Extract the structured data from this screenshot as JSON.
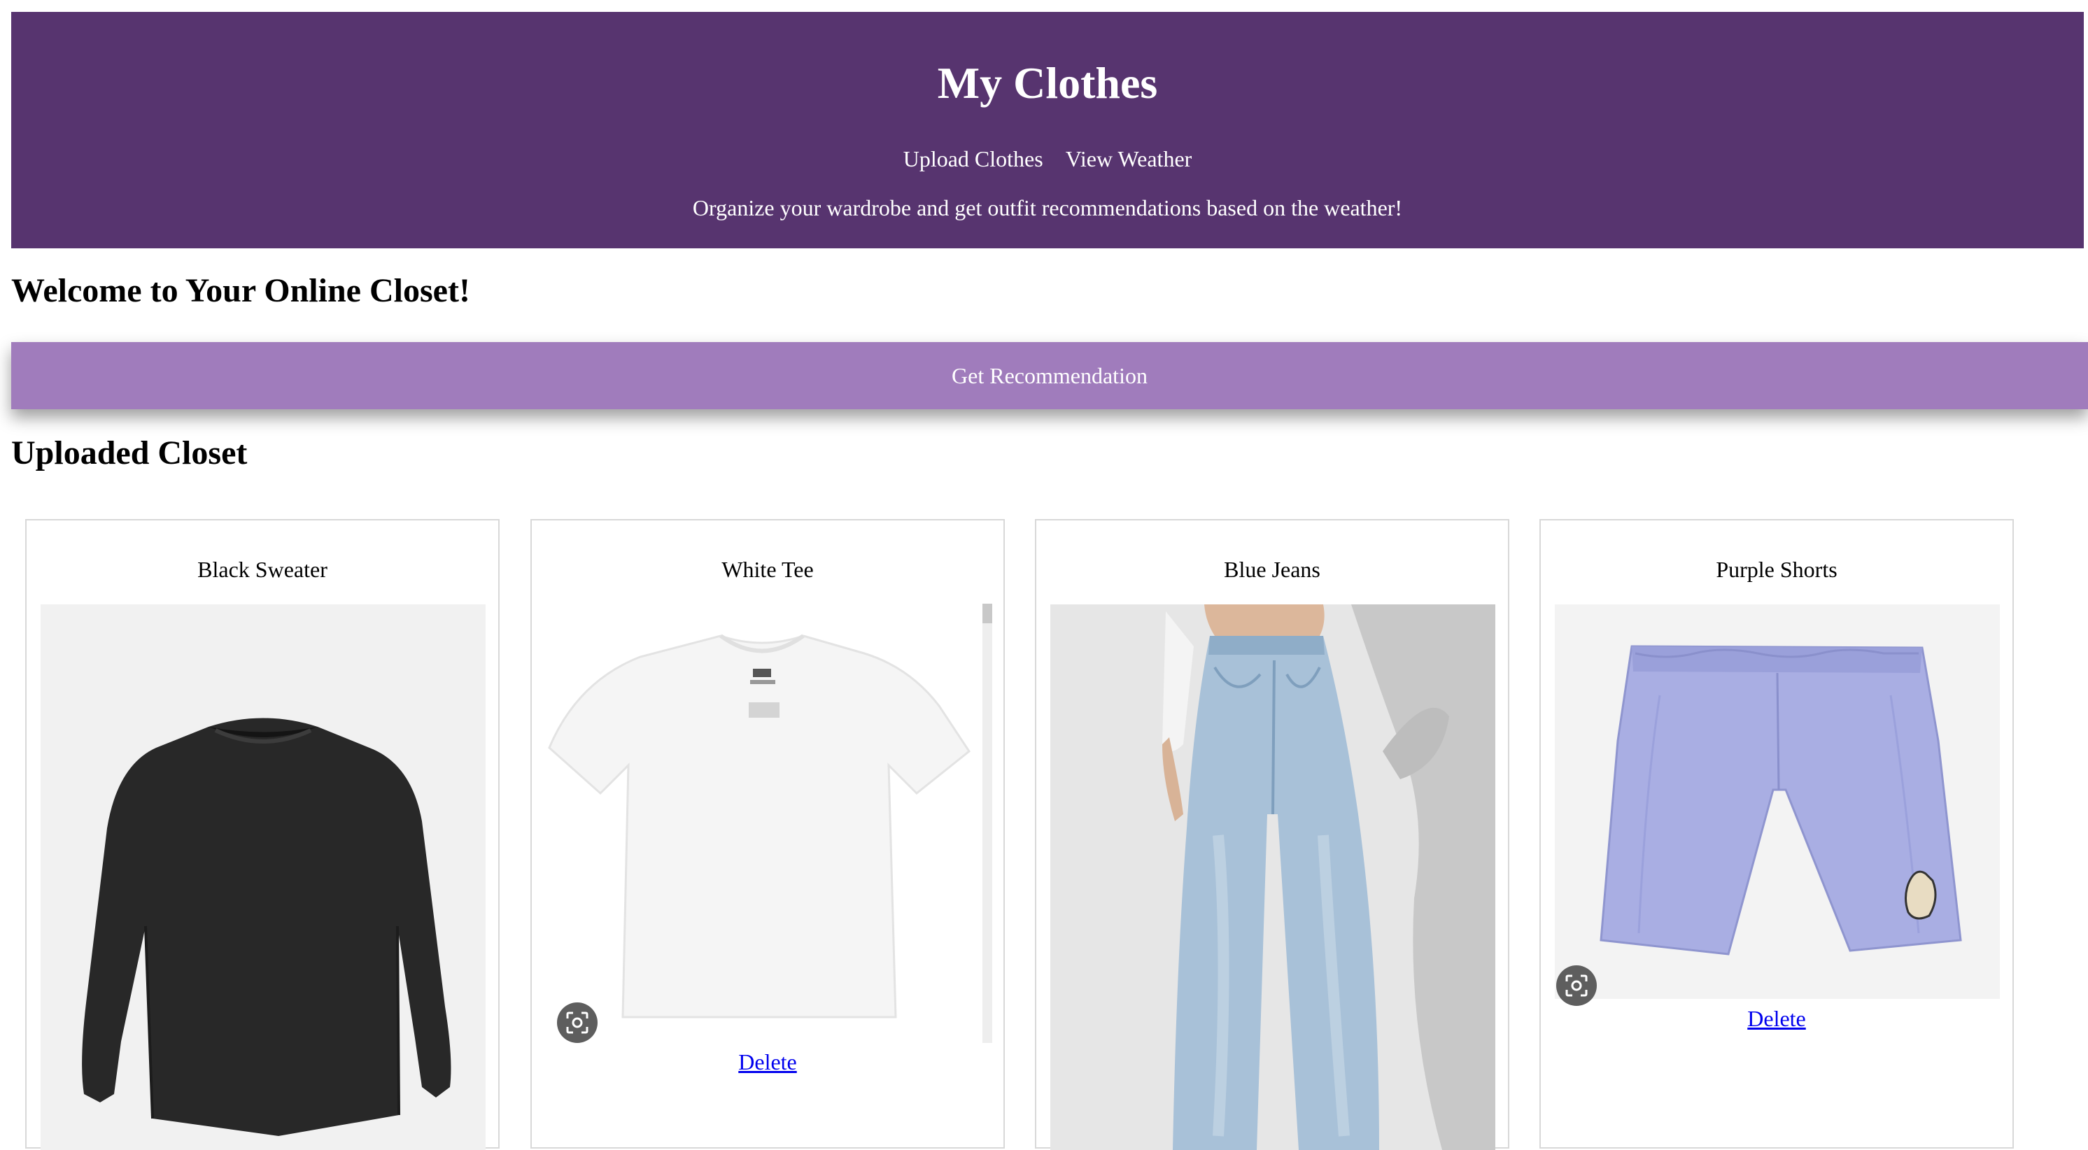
{
  "header": {
    "title": "My Clothes",
    "nav": [
      "Upload Clothes",
      "View Weather"
    ],
    "tagline": "Organize your wardrobe and get outfit recommendations based on the weather!"
  },
  "welcome_heading": "Welcome to Your Online Closet!",
  "recommend_button": "Get Recommendation",
  "closet": {
    "heading": "Uploaded Closet",
    "items": [
      {
        "name": "Black Sweater",
        "delete_label": ""
      },
      {
        "name": "White Tee",
        "delete_label": "Delete"
      },
      {
        "name": "Blue Jeans",
        "delete_label": ""
      },
      {
        "name": "Purple Shorts",
        "delete_label": "Delete"
      }
    ]
  },
  "icons": {
    "image_search": "lens-search-icon"
  },
  "colors": {
    "header_bg": "#57346f",
    "button_bg": "#a07cbc",
    "link": "#0000ee"
  }
}
